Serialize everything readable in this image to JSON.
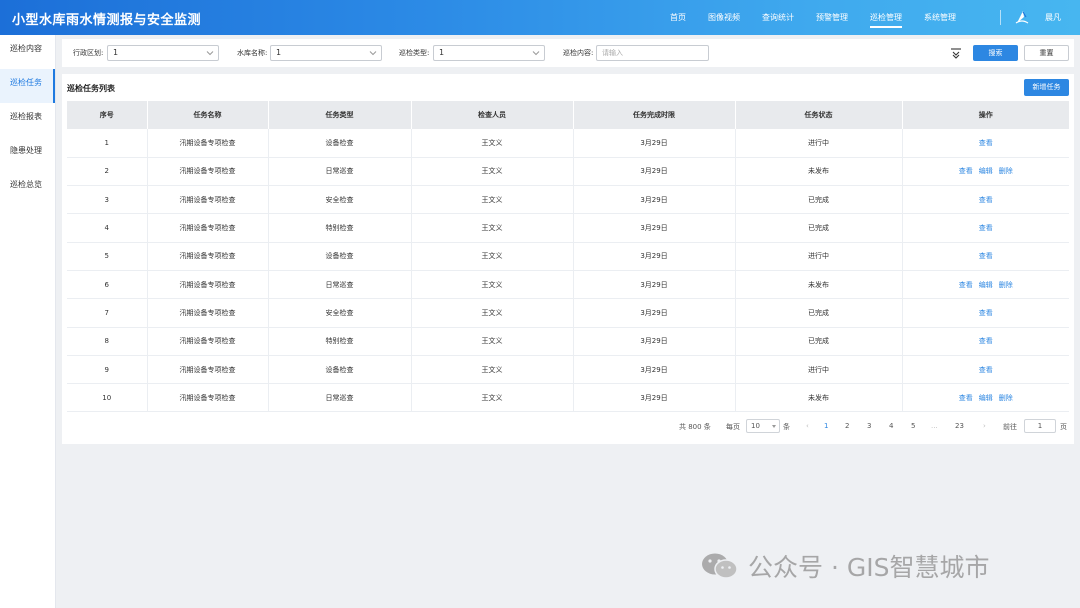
{
  "app": {
    "title": "小型水库雨水情测报与安全监测"
  },
  "topnav": [
    {
      "label": "首页"
    },
    {
      "label": "图像视频"
    },
    {
      "label": "查询统计"
    },
    {
      "label": "预警管理"
    },
    {
      "label": "巡检管理",
      "active": true
    },
    {
      "label": "系统管理"
    }
  ],
  "user": {
    "name": "晨凡"
  },
  "sidebar": [
    {
      "label": "巡检内容"
    },
    {
      "label": "巡检任务",
      "active": true
    },
    {
      "label": "巡检报表"
    },
    {
      "label": "隐患处理"
    },
    {
      "label": "巡检总览"
    }
  ],
  "filters": {
    "region_label": "行政区划:",
    "region_value": "1",
    "reservoir_label": "水库名称:",
    "reservoir_value": "1",
    "type_label": "巡检类型:",
    "type_value": "1",
    "content_label": "巡检内容:",
    "content_placeholder": "请输入",
    "search_label": "搜索",
    "reset_label": "重置"
  },
  "list": {
    "title": "巡检任务列表",
    "add_label": "新增任务",
    "columns": [
      "序号",
      "任务名称",
      "任务类型",
      "检查人员",
      "任务完成时限",
      "任务状态",
      "操作"
    ],
    "rows": [
      {
        "id": "1",
        "name": "汛期设备专项检查",
        "type": "设备检查",
        "inspector": "王文义",
        "deadline": "3月29日",
        "status": "进行中",
        "actions": [
          "查看"
        ]
      },
      {
        "id": "2",
        "name": "汛期设备专项检查",
        "type": "日常巡查",
        "inspector": "王文义",
        "deadline": "3月29日",
        "status": "未发布",
        "actions": [
          "查看",
          "编辑",
          "删除"
        ]
      },
      {
        "id": "3",
        "name": "汛期设备专项检查",
        "type": "安全检查",
        "inspector": "王文义",
        "deadline": "3月29日",
        "status": "已完成",
        "actions": [
          "查看"
        ]
      },
      {
        "id": "4",
        "name": "汛期设备专项检查",
        "type": "特别检查",
        "inspector": "王文义",
        "deadline": "3月29日",
        "status": "已完成",
        "actions": [
          "查看"
        ]
      },
      {
        "id": "5",
        "name": "汛期设备专项检查",
        "type": "设备检查",
        "inspector": "王文义",
        "deadline": "3月29日",
        "status": "进行中",
        "actions": [
          "查看"
        ]
      },
      {
        "id": "6",
        "name": "汛期设备专项检查",
        "type": "日常巡查",
        "inspector": "王文义",
        "deadline": "3月29日",
        "status": "未发布",
        "actions": [
          "查看",
          "编辑",
          "删除"
        ]
      },
      {
        "id": "7",
        "name": "汛期设备专项检查",
        "type": "安全检查",
        "inspector": "王文义",
        "deadline": "3月29日",
        "status": "已完成",
        "actions": [
          "查看"
        ]
      },
      {
        "id": "8",
        "name": "汛期设备专项检查",
        "type": "特别检查",
        "inspector": "王文义",
        "deadline": "3月29日",
        "status": "已完成",
        "actions": [
          "查看"
        ]
      },
      {
        "id": "9",
        "name": "汛期设备专项检查",
        "type": "设备检查",
        "inspector": "王文义",
        "deadline": "3月29日",
        "status": "进行中",
        "actions": [
          "查看"
        ]
      },
      {
        "id": "10",
        "name": "汛期设备专项检查",
        "type": "日常巡查",
        "inspector": "王文义",
        "deadline": "3月29日",
        "status": "未发布",
        "actions": [
          "查看",
          "编辑",
          "删除"
        ]
      }
    ]
  },
  "pagination": {
    "total_text": "共 800 条",
    "per_page_prefix": "每页",
    "per_page_value": "10",
    "per_page_suffix": "条",
    "prev": "‹",
    "pages": [
      "1",
      "2",
      "3",
      "4",
      "5",
      "...",
      "23"
    ],
    "current_page": "1",
    "next": "›",
    "goto_prefix": "前往",
    "goto_value": "1",
    "goto_suffix": "页"
  },
  "watermark": {
    "text": "公众号 · GIS智慧城市"
  },
  "colors": {
    "primary": "#2d87e2",
    "header_start": "#1c6fd8",
    "header_end": "#47b6f0"
  }
}
